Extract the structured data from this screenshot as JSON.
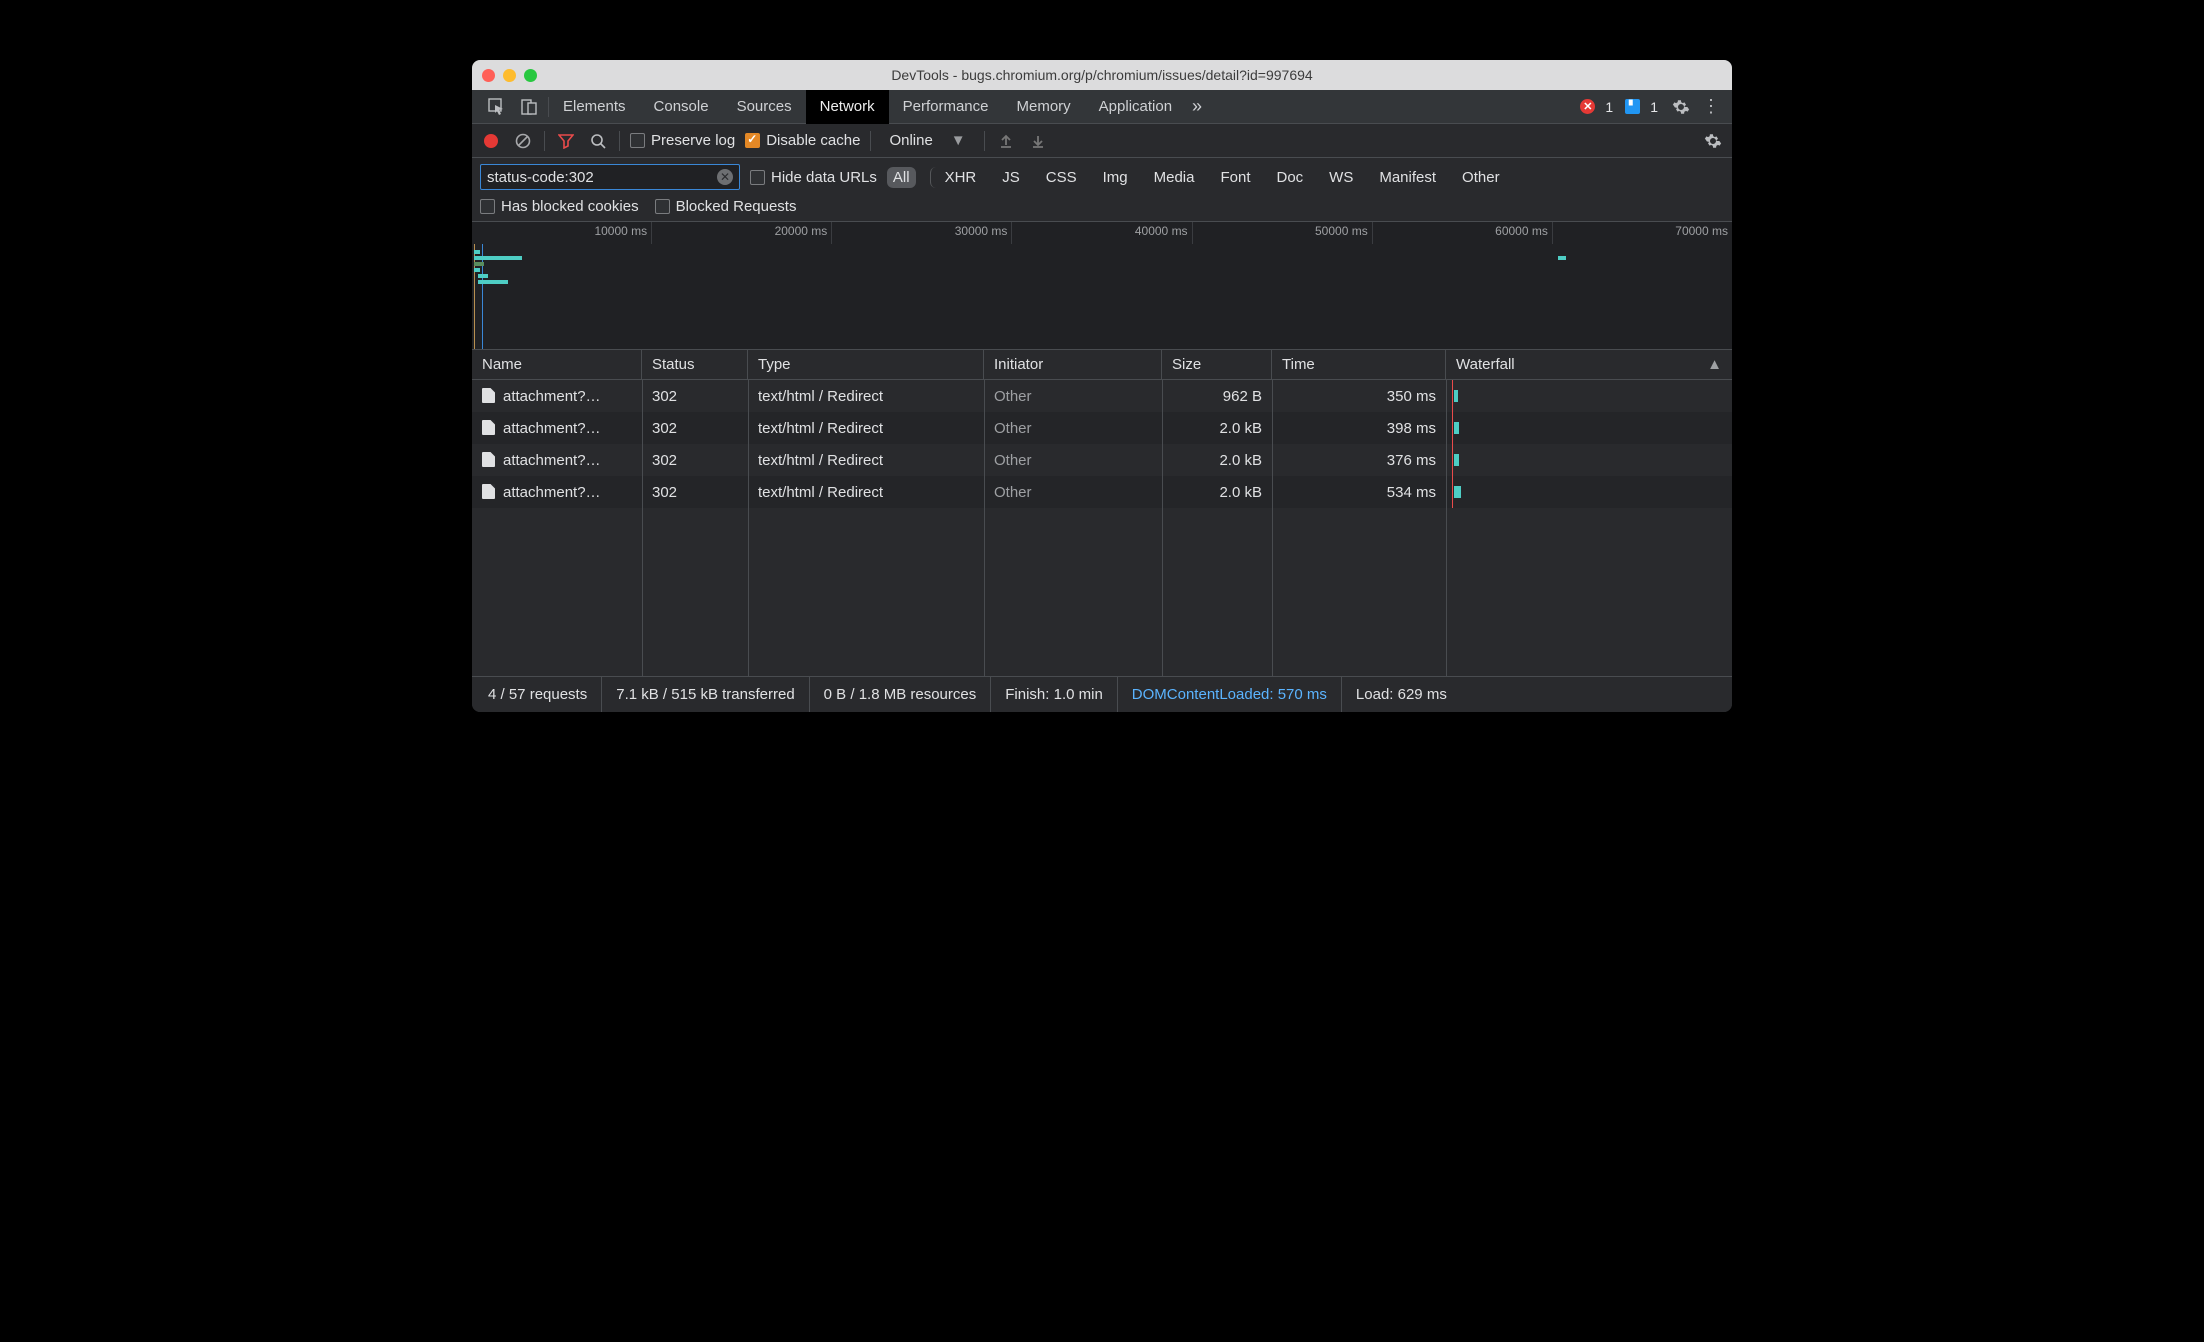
{
  "window": {
    "title": "DevTools - bugs.chromium.org/p/chromium/issues/detail?id=997694"
  },
  "tabs": {
    "items": [
      "Elements",
      "Console",
      "Sources",
      "Network",
      "Performance",
      "Memory",
      "Application"
    ],
    "active": "Network",
    "overflow_icon": "chevron-double-right",
    "error_count": "1",
    "message_count": "1"
  },
  "toolbar": {
    "preserve_log_label": "Preserve log",
    "preserve_log_checked": false,
    "disable_cache_label": "Disable cache",
    "disable_cache_checked": true,
    "throttling": "Online"
  },
  "filter": {
    "value": "status-code:302",
    "hide_data_urls_label": "Hide data URLs",
    "types": [
      "All",
      "XHR",
      "JS",
      "CSS",
      "Img",
      "Media",
      "Font",
      "Doc",
      "WS",
      "Manifest",
      "Other"
    ],
    "type_active": "All",
    "has_blocked_cookies_label": "Has blocked cookies",
    "blocked_requests_label": "Blocked Requests"
  },
  "overview": {
    "ticks": [
      "10000 ms",
      "20000 ms",
      "30000 ms",
      "40000 ms",
      "50000 ms",
      "60000 ms",
      "70000 ms"
    ]
  },
  "table": {
    "columns": [
      "Name",
      "Status",
      "Type",
      "Initiator",
      "Size",
      "Time",
      "Waterfall"
    ],
    "sort_column": "Waterfall",
    "rows": [
      {
        "name": "attachment?…",
        "status": "302",
        "type": "text/html / Redirect",
        "initiator": "Other",
        "size": "962 B",
        "time": "350 ms"
      },
      {
        "name": "attachment?…",
        "status": "302",
        "type": "text/html / Redirect",
        "initiator": "Other",
        "size": "2.0 kB",
        "time": "398 ms"
      },
      {
        "name": "attachment?…",
        "status": "302",
        "type": "text/html / Redirect",
        "initiator": "Other",
        "size": "2.0 kB",
        "time": "376 ms"
      },
      {
        "name": "attachment?…",
        "status": "302",
        "type": "text/html / Redirect",
        "initiator": "Other",
        "size": "2.0 kB",
        "time": "534 ms"
      }
    ]
  },
  "status": {
    "requests": "4 / 57 requests",
    "transferred": "7.1 kB / 515 kB transferred",
    "resources": "0 B / 1.8 MB resources",
    "finish": "Finish: 1.0 min",
    "dom": "DOMContentLoaded: 570 ms",
    "load": "Load: 629 ms"
  }
}
